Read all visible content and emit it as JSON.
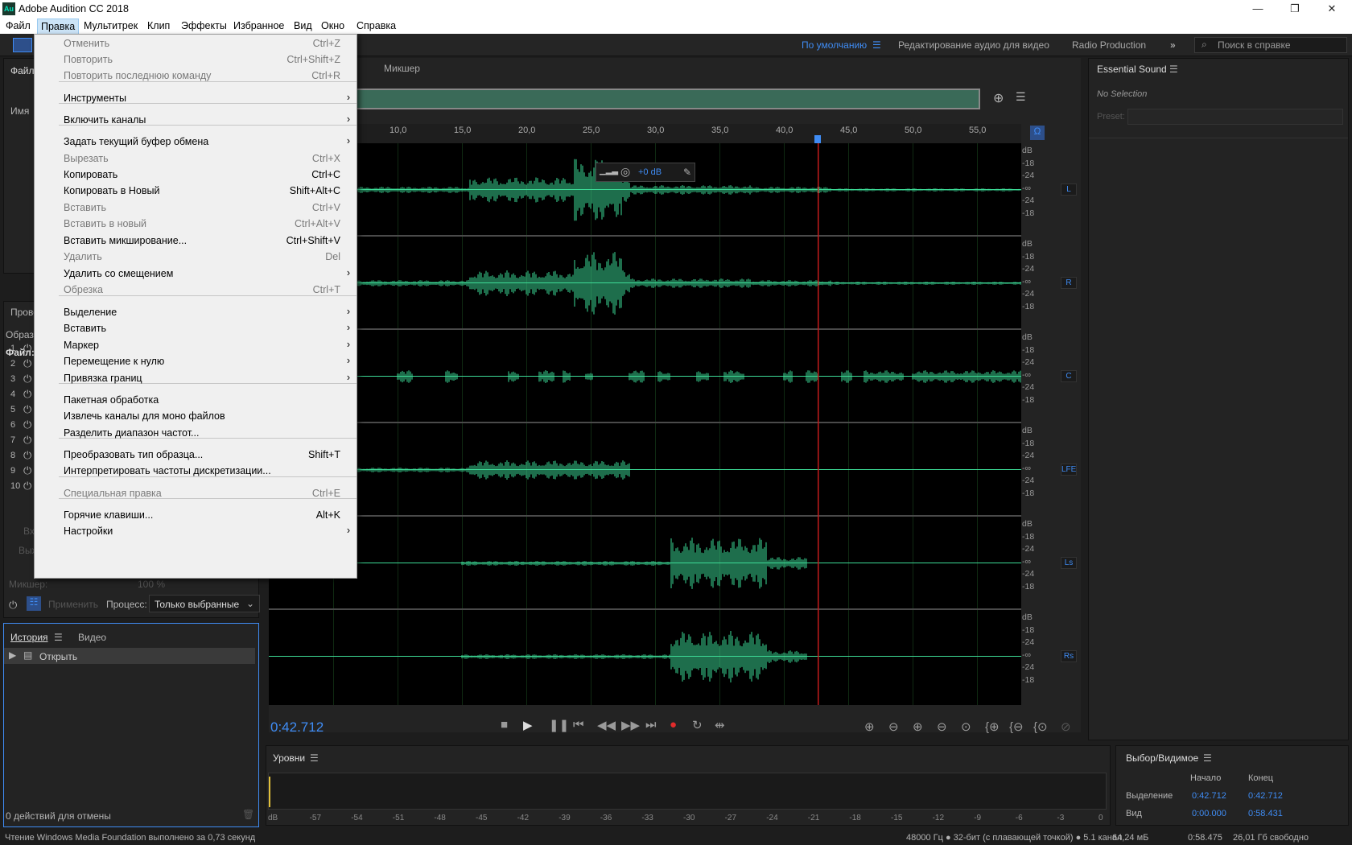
{
  "window": {
    "title": "Adobe Audition CC 2018",
    "logo": "Au",
    "min": "—",
    "max": "❐",
    "close": "✕"
  },
  "menubar": [
    "Файл",
    "Правка",
    "Мультитрек",
    "Клип",
    "Эффекты",
    "Избранное",
    "Вид",
    "Окно",
    "Справка"
  ],
  "workspaces": {
    "default": "По умолчанию",
    "video": "Редактирование аудио для видео",
    "radio": "Radio Production",
    "search_placeholder": "Поиск в справке"
  },
  "edit_menu": [
    {
      "label": "Отменить",
      "shortcut": "Ctrl+Z",
      "disabled": true
    },
    {
      "label": "Повторить",
      "shortcut": "Ctrl+Shift+Z",
      "disabled": true
    },
    {
      "label": "Повторить последнюю команду",
      "shortcut": "Ctrl+R",
      "disabled": true
    },
    {
      "label": "Инструменты",
      "submenu": true
    },
    {
      "label": "Включить каналы",
      "submenu": true
    },
    {
      "label": "Задать текущий буфер обмена",
      "submenu": true
    },
    {
      "label": "Вырезать",
      "shortcut": "Ctrl+X",
      "disabled": true
    },
    {
      "label": "Копировать",
      "shortcut": "Ctrl+C"
    },
    {
      "label": "Копировать в Новый",
      "shortcut": "Shift+Alt+C"
    },
    {
      "label": "Вставить",
      "shortcut": "Ctrl+V",
      "disabled": true
    },
    {
      "label": "Вставить в новый",
      "shortcut": "Ctrl+Alt+V",
      "disabled": true
    },
    {
      "label": "Вставить микширование...",
      "shortcut": "Ctrl+Shift+V"
    },
    {
      "label": "Удалить",
      "shortcut": "Del",
      "disabled": true
    },
    {
      "label": "Удалить со смещением",
      "submenu": true
    },
    {
      "label": "Обрезка",
      "shortcut": "Ctrl+T",
      "disabled": true
    },
    {
      "label": "Выделение",
      "submenu": true
    },
    {
      "label": "Вставить",
      "submenu": true
    },
    {
      "label": "Маркер",
      "submenu": true
    },
    {
      "label": "Перемещение к нулю",
      "submenu": true
    },
    {
      "label": "Привязка границ",
      "submenu": true
    },
    {
      "label": "Пакетная обработка"
    },
    {
      "label": "Извлечь каналы для моно файлов"
    },
    {
      "label": "Разделить диапазон частот..."
    },
    {
      "label": "Преобразовать тип образца...",
      "shortcut": "Shift+T"
    },
    {
      "label": "Интерпретировать частоты дискретизации..."
    },
    {
      "label": "Специальная правка",
      "shortcut": "Ctrl+E",
      "disabled": true
    },
    {
      "label": "Горячие клавиши...",
      "shortcut": "Alt+K"
    },
    {
      "label": "Настройки",
      "submenu": true
    }
  ],
  "left": {
    "files_tab": "Файлы",
    "name_col": "Имя",
    "effects_tab": "Прово",
    "obraz": "Образц",
    "file_label": "Файл: р",
    "rack": [
      "1",
      "2",
      "3",
      "4",
      "5",
      "6",
      "7",
      "8",
      "9",
      "10"
    ],
    "input": "Вход",
    "output": "Выхо",
    "mixer": "Микшер:",
    "mixer_val": "100 %",
    "apply": "Применить",
    "process": "Процесс:",
    "process_val": "Только выбранные",
    "history_tab": "История",
    "video_tab": "Видео",
    "history_item": "Открыть",
    "undo_count": "0 действий для отмены"
  },
  "editor": {
    "mixer_tab": "Микшер",
    "ruler": [
      "10,0",
      "15,0",
      "20,0",
      "25,0",
      "30,0",
      "35,0",
      "40,0",
      "45,0",
      "50,0",
      "55,0"
    ],
    "gain_hud": "+0 dB",
    "channels": [
      "L",
      "R",
      "C",
      "LFE",
      "Ls",
      "Rs"
    ],
    "db_scale": [
      "dB",
      "-18",
      "-24",
      "-∞",
      "-24",
      "-18"
    ],
    "time": "0:42.712"
  },
  "essential": {
    "title": "Essential Sound",
    "no_selection": "No Selection",
    "preset": "Preset:"
  },
  "levels": {
    "title": "Уровни",
    "scale": [
      "dB",
      "-57",
      "-54",
      "-51",
      "-48",
      "-45",
      "-42",
      "-39",
      "-36",
      "-33",
      "-30",
      "-27",
      "-24",
      "-21",
      "-18",
      "-15",
      "-12",
      "-9",
      "-6",
      "-3",
      "0"
    ]
  },
  "selection": {
    "title": "Выбор/Видимое",
    "start": "Начало",
    "end": "Конец",
    "sel_label": "Выделение",
    "sel_start": "0:42.712",
    "sel_end": "0:42.712",
    "view_label": "Вид",
    "view_start": "0:00.000",
    "view_end": "0:58.431"
  },
  "status": {
    "left": "Чтение Windows Media Foundation выполнено за 0,73 секунд",
    "format": "48000 Гц ● 32-бит (с плавающей точкой) ● 5.1 канал",
    "size": "64,24 мБ",
    "duration": "0:58.475",
    "free": "26,01 Гб свободно"
  },
  "colors": {
    "accent": "#3f8cf4",
    "wave": "#3ddc97",
    "playhead": "#c21c1c",
    "record": "#e22b2b"
  }
}
